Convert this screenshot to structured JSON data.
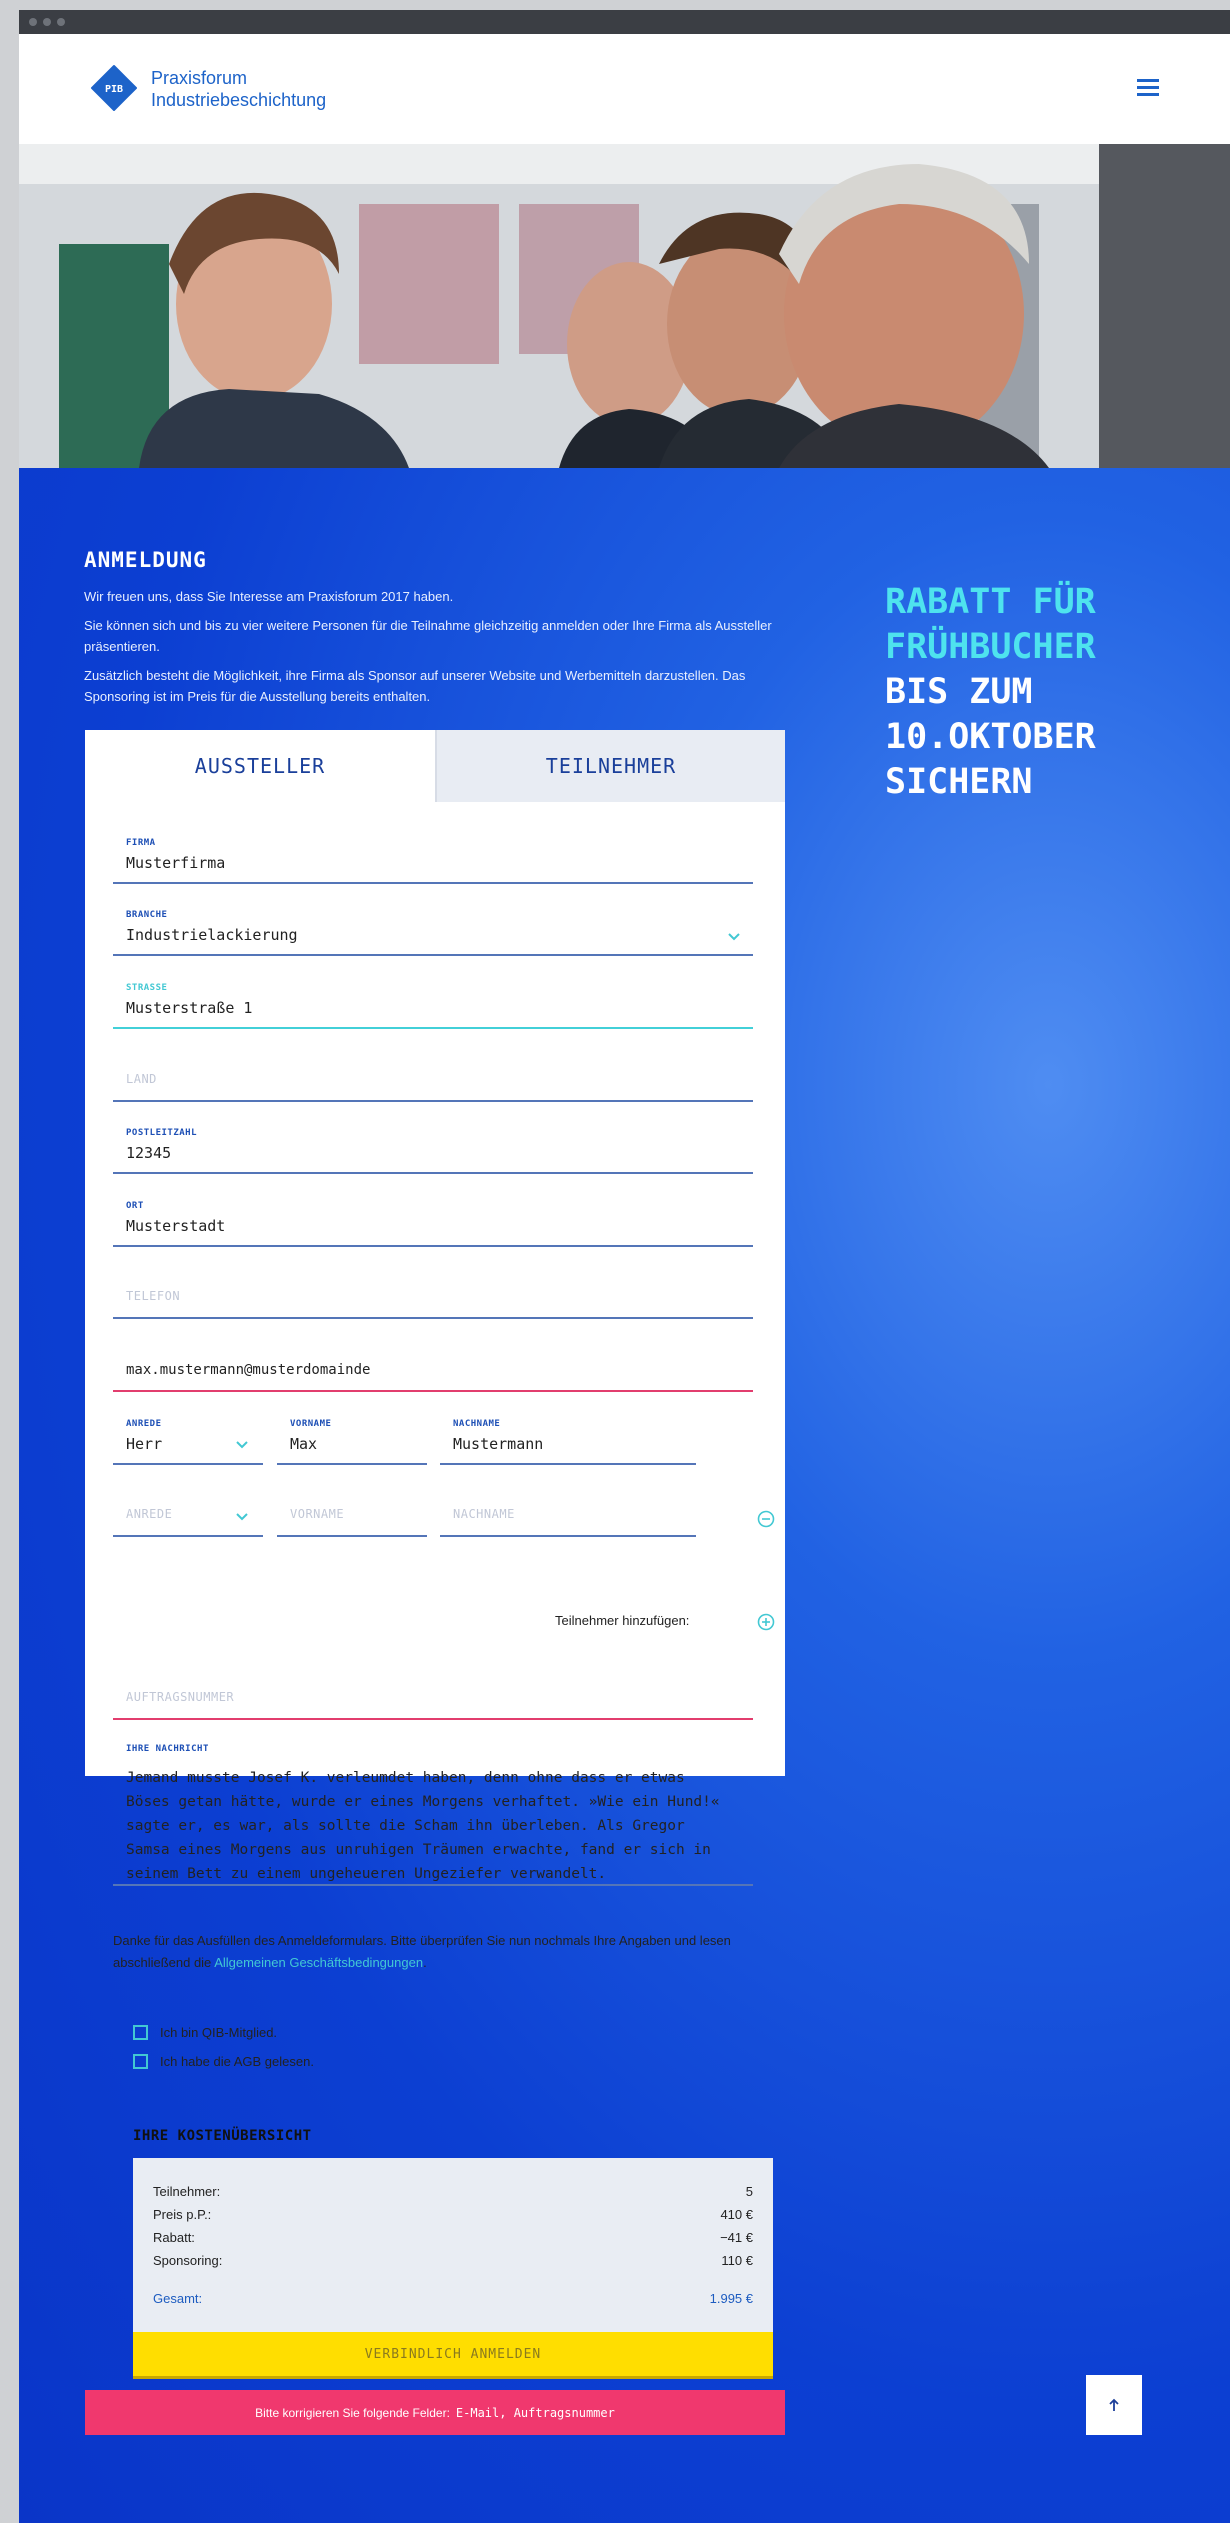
{
  "brand": {
    "logo_short": "PIB",
    "line1": "Praxisforum",
    "line2": "Industriebeschichtung"
  },
  "intro": {
    "title": "ANMELDUNG",
    "p1": "Wir freuen uns, dass Sie Interesse am Praxisforum 2017 haben.",
    "p2": "Sie können sich und bis zu vier weitere Personen für die Teilnahme gleichzeitig anmelden oder Ihre Firma als Aussteller präsentieren.",
    "p3": "Zusätzlich besteht die Möglichkeit, ihre Firma als Sponsor auf unserer Website und Werbemitteln darzustellen. Das Sponsoring ist im Preis für die Ausstellung bereits enthalten."
  },
  "promo": {
    "line1": "RABATT FÜR",
    "line2": "FRÜHBUCHER",
    "line3": "BIS ZUM",
    "line4": "10.OKTOBER",
    "line5": "SICHERN"
  },
  "tabs": {
    "aussteller": "AUSSTELLER",
    "teilnehmer": "TEILNEHMER"
  },
  "form": {
    "firma": {
      "label": "FIRMA",
      "value": "Musterfirma"
    },
    "branche": {
      "label": "BRANCHE",
      "value": "Industrielackierung"
    },
    "strasse": {
      "label": "STRASSE",
      "value": "Musterstraße 1"
    },
    "land": {
      "placeholder": "LAND"
    },
    "plz": {
      "label": "POSTLEITZAHL",
      "value": "12345"
    },
    "ort": {
      "label": "ORT",
      "value": "Musterstadt"
    },
    "telefon": {
      "placeholder": "TELEFON"
    },
    "email": {
      "value": "max.mustermann@musterdomainde"
    },
    "p1": {
      "anrede_label": "ANREDE",
      "anrede_value": "Herr",
      "vorname_label": "VORNAME",
      "vorname_value": "Max",
      "nachname_label": "NACHNAME",
      "nachname_value": "Mustermann"
    },
    "p2": {
      "anrede_ph": "ANREDE",
      "vorname_ph": "VORNAME",
      "nachname_ph": "NACHNAME"
    },
    "add_participant": "Teilnehmer hinzufügen:",
    "auftragsnummer": {
      "placeholder": "AUFTRAGSNUMMER"
    },
    "nachricht": {
      "label": "IHRE NACHRICHT",
      "value": "Jemand musste Josef K. verleumdet haben, denn ohne dass er etwas Böses getan hätte, wurde er eines Morgens verhaftet. »Wie ein Hund!« sagte er, es war, als sollte die Scham ihn überleben. Als Gregor Samsa eines Morgens aus unruhigen Träumen erwachte, fand er sich in seinem Bett zu einem ungeheueren Ungeziefer verwandelt."
    }
  },
  "thanks": {
    "text": "Danke für das Ausfüllen des Anmeldeformulars. Bitte überprüfen Sie nun nochmals Ihre Angaben und lesen abschließend die ",
    "link": "Allgemeinen Geschäftsbedingungen",
    "end": "."
  },
  "checks": {
    "member": "Ich bin QIB-Mitglied.",
    "agb": "Ich habe die AGB gelesen."
  },
  "costs": {
    "title": "IHRE KOSTENÜBERSICHT",
    "rows": [
      {
        "label": "Teilnehmer:",
        "value": "5"
      },
      {
        "label": "Preis p.P.:",
        "value": "410 €"
      },
      {
        "label": "Rabatt:",
        "value": "−41 €"
      },
      {
        "label": "Sponsoring:",
        "value": "110 €"
      }
    ],
    "total_label": "Gesamt:",
    "total_value": "1.995 €"
  },
  "submit_label": "VERBINDLICH ANMELDEN",
  "error": {
    "text": "Bitte korrigieren Sie folgende Felder:",
    "fields": "E-Mail, Auftragsnummer"
  },
  "colors": {
    "primary_blue": "#0c3fd2",
    "accent_cyan": "#4ee3ee",
    "error_pink": "#f0386e",
    "submit_yellow": "#ffde00"
  }
}
